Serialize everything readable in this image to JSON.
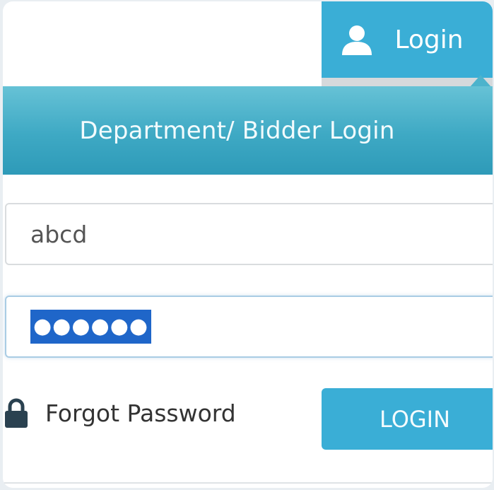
{
  "tab": {
    "label": "Login",
    "icon": "user-icon"
  },
  "panel": {
    "title": "Department/ Bidder Login"
  },
  "form": {
    "username_value": "abcd",
    "password_value": "●●●●●●",
    "forgot_label": "Forgot Password",
    "forgot_icon": "lock-icon",
    "submit_label": "LOGIN"
  },
  "colors": {
    "accent": "#3aaed6",
    "header": "#3ea9c4",
    "selection": "#1f66c9"
  }
}
